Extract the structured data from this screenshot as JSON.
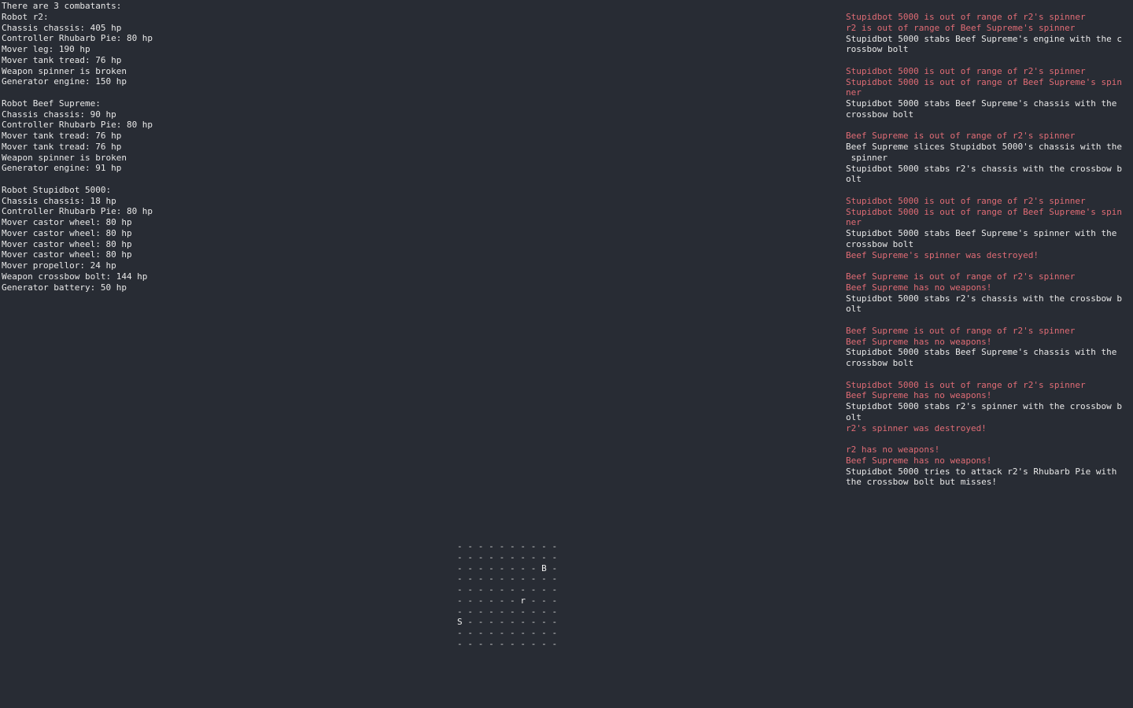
{
  "status": {
    "lines": [
      "There are 3 combatants:",
      "Robot r2:",
      "Chassis chassis: 405 hp",
      "Controller Rhubarb Pie: 80 hp",
      "Mover leg: 190 hp",
      "Mover tank tread: 76 hp",
      "Weapon spinner is broken",
      "Generator engine: 150 hp",
      "",
      "Robot Beef Supreme:",
      "Chassis chassis: 90 hp",
      "Controller Rhubarb Pie: 80 hp",
      "Mover tank tread: 76 hp",
      "Mover tank tread: 76 hp",
      "Weapon spinner is broken",
      "Generator engine: 91 hp",
      "",
      "Robot Stupidbot 5000:",
      "Chassis chassis: 18 hp",
      "Controller Rhubarb Pie: 80 hp",
      "Mover castor wheel: 80 hp",
      "Mover castor wheel: 80 hp",
      "Mover castor wheel: 80 hp",
      "Mover castor wheel: 80 hp",
      "Mover propellor: 24 hp",
      "Weapon crossbow bolt: 144 hp",
      "Generator battery: 50 hp"
    ]
  },
  "log": {
    "colors": {
      "warn": "#e06c75",
      "act": "#e8e8e8"
    },
    "lines": [
      {
        "type": "warn",
        "text": "Stupidbot 5000 is out of range of r2's spinner"
      },
      {
        "type": "warn",
        "text": "r2 is out of range of Beef Supreme's spinner"
      },
      {
        "type": "act",
        "text": "Stupidbot 5000 stabs Beef Supreme's engine with the c"
      },
      {
        "type": "act",
        "text": "rossbow bolt"
      },
      {
        "type": "act",
        "text": ""
      },
      {
        "type": "warn",
        "text": "Stupidbot 5000 is out of range of r2's spinner"
      },
      {
        "type": "warn",
        "text": "Stupidbot 5000 is out of range of Beef Supreme's spin"
      },
      {
        "type": "warn",
        "text": "ner"
      },
      {
        "type": "act",
        "text": "Stupidbot 5000 stabs Beef Supreme's chassis with the"
      },
      {
        "type": "act",
        "text": "crossbow bolt"
      },
      {
        "type": "act",
        "text": ""
      },
      {
        "type": "warn",
        "text": "Beef Supreme is out of range of r2's spinner"
      },
      {
        "type": "act",
        "text": "Beef Supreme slices Stupidbot 5000's chassis with the"
      },
      {
        "type": "act",
        "text": " spinner"
      },
      {
        "type": "act",
        "text": "Stupidbot 5000 stabs r2's chassis with the crossbow b"
      },
      {
        "type": "act",
        "text": "olt"
      },
      {
        "type": "act",
        "text": ""
      },
      {
        "type": "warn",
        "text": "Stupidbot 5000 is out of range of r2's spinner"
      },
      {
        "type": "warn",
        "text": "Stupidbot 5000 is out of range of Beef Supreme's spin"
      },
      {
        "type": "warn",
        "text": "ner"
      },
      {
        "type": "act",
        "text": "Stupidbot 5000 stabs Beef Supreme's spinner with the"
      },
      {
        "type": "act",
        "text": "crossbow bolt"
      },
      {
        "type": "warn",
        "text": "Beef Supreme's spinner was destroyed!"
      },
      {
        "type": "act",
        "text": ""
      },
      {
        "type": "warn",
        "text": "Beef Supreme is out of range of r2's spinner"
      },
      {
        "type": "warn",
        "text": "Beef Supreme has no weapons!"
      },
      {
        "type": "act",
        "text": "Stupidbot 5000 stabs r2's chassis with the crossbow b"
      },
      {
        "type": "act",
        "text": "olt"
      },
      {
        "type": "act",
        "text": ""
      },
      {
        "type": "warn",
        "text": "Beef Supreme is out of range of r2's spinner"
      },
      {
        "type": "warn",
        "text": "Beef Supreme has no weapons!"
      },
      {
        "type": "act",
        "text": "Stupidbot 5000 stabs Beef Supreme's chassis with the"
      },
      {
        "type": "act",
        "text": "crossbow bolt"
      },
      {
        "type": "act",
        "text": ""
      },
      {
        "type": "warn",
        "text": "Stupidbot 5000 is out of range of r2's spinner"
      },
      {
        "type": "warn",
        "text": "Beef Supreme has no weapons!"
      },
      {
        "type": "act",
        "text": "Stupidbot 5000 stabs r2's spinner with the crossbow b"
      },
      {
        "type": "act",
        "text": "olt"
      },
      {
        "type": "warn",
        "text": "r2's spinner was destroyed!"
      },
      {
        "type": "act",
        "text": ""
      },
      {
        "type": "warn",
        "text": "r2 has no weapons!"
      },
      {
        "type": "warn",
        "text": "Beef Supreme has no weapons!"
      },
      {
        "type": "act",
        "text": "Stupidbot 5000 tries to attack r2's Rhubarb Pie with"
      },
      {
        "type": "act",
        "text": "the crossbow bolt but misses!"
      }
    ]
  },
  "arena": {
    "rows": [
      [
        "-",
        "-",
        "-",
        "-",
        "-",
        "-",
        "-",
        "-",
        "-",
        "-"
      ],
      [
        "-",
        "-",
        "-",
        "-",
        "-",
        "-",
        "-",
        "-",
        "-",
        "-"
      ],
      [
        "-",
        "-",
        "-",
        "-",
        "-",
        "-",
        "-",
        "-",
        "B",
        "-"
      ],
      [
        "-",
        "-",
        "-",
        "-",
        "-",
        "-",
        "-",
        "-",
        "-",
        "-"
      ],
      [
        "-",
        "-",
        "-",
        "-",
        "-",
        "-",
        "-",
        "-",
        "-",
        "-"
      ],
      [
        "-",
        "-",
        "-",
        "-",
        "-",
        "-",
        "r",
        "-",
        "-",
        "-"
      ],
      [
        "-",
        "-",
        "-",
        "-",
        "-",
        "-",
        "-",
        "-",
        "-",
        "-"
      ],
      [
        "S",
        "-",
        "-",
        "-",
        "-",
        "-",
        "-",
        "-",
        "-",
        "-"
      ],
      [
        "-",
        "-",
        "-",
        "-",
        "-",
        "-",
        "-",
        "-",
        "-",
        "-"
      ],
      [
        "-",
        "-",
        "-",
        "-",
        "-",
        "-",
        "-",
        "-",
        "-",
        "-"
      ]
    ]
  }
}
